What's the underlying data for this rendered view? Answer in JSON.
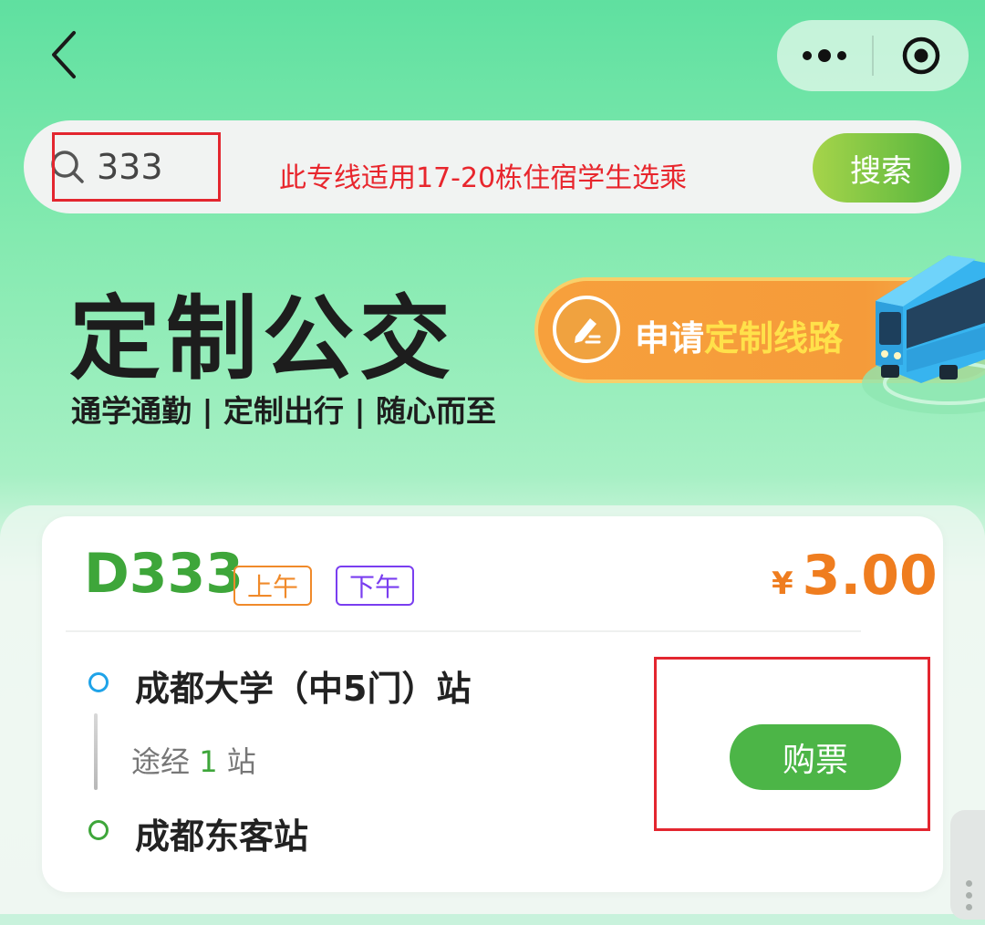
{
  "nav": {
    "back_icon": "chevron-left-icon",
    "more_icon": "more-dots-icon",
    "close_icon": "target-close-icon"
  },
  "search": {
    "value": "333",
    "placeholder": "",
    "notice": "此专线适用17-20栋住宿学生选乘",
    "button_label": "搜索"
  },
  "banner": {
    "title": "定制公交",
    "subtitle": "通学通勤 | 定制出行 | 随心而至",
    "apply_label_white": "申请",
    "apply_label_yellow": "定制线路"
  },
  "route": {
    "code": "D333",
    "tags": [
      "上午",
      "下午"
    ],
    "price_symbol": "¥",
    "price": "3.00",
    "start_stop": "成都大学（中5门）站",
    "via_prefix": "途经",
    "via_count": "1",
    "via_suffix": "站",
    "end_stop": "成都东客站",
    "buy_label": "购票"
  },
  "colors": {
    "accent_green": "#3ea63a",
    "price_orange": "#ef7d1f",
    "tag_am": "#f08a2a",
    "tag_pm": "#7a3ef0",
    "annotation_red": "#e3262f"
  }
}
